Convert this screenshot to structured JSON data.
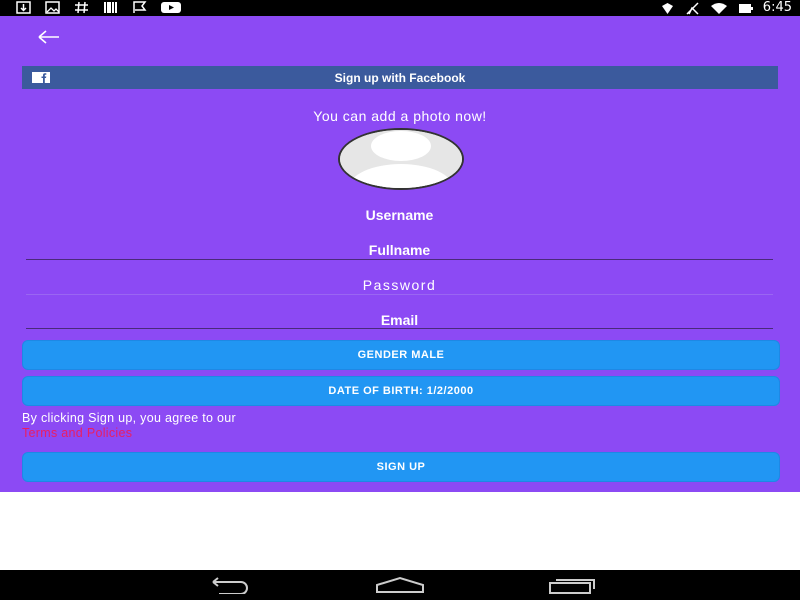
{
  "status_bar": {
    "left_icons": [
      "download-icon",
      "image-icon",
      "hashtag-icon",
      "barcode-icon",
      "flag-icon",
      "youtube-icon"
    ],
    "right_icons": [
      "location-icon",
      "no-signal-icon",
      "wifi-icon",
      "battery-icon"
    ],
    "time": "6:45"
  },
  "header": {
    "back_icon": "arrow-left-icon"
  },
  "facebook": {
    "label": "Sign up with Facebook",
    "color": "#3b5a9d"
  },
  "photo": {
    "prompt": "You can add a photo now!"
  },
  "form": {
    "username": "Username",
    "fullname": "Fullname",
    "password": "Password",
    "email": "Email"
  },
  "buttons": {
    "gender": "GENDER MALE",
    "dob": "DATE OF BIRTH: 1/2/2000",
    "signup": "SIGN UP",
    "color": "#2196f3"
  },
  "agreement": {
    "text": "By clicking Sign up, you agree to our",
    "link": "Terms and Policies",
    "link_color": "#e91e63"
  },
  "nav_bar": {
    "icons": [
      "back-nav-icon",
      "home-nav-icon",
      "recents-nav-icon"
    ]
  },
  "colors": {
    "background": "#8c4af4"
  }
}
